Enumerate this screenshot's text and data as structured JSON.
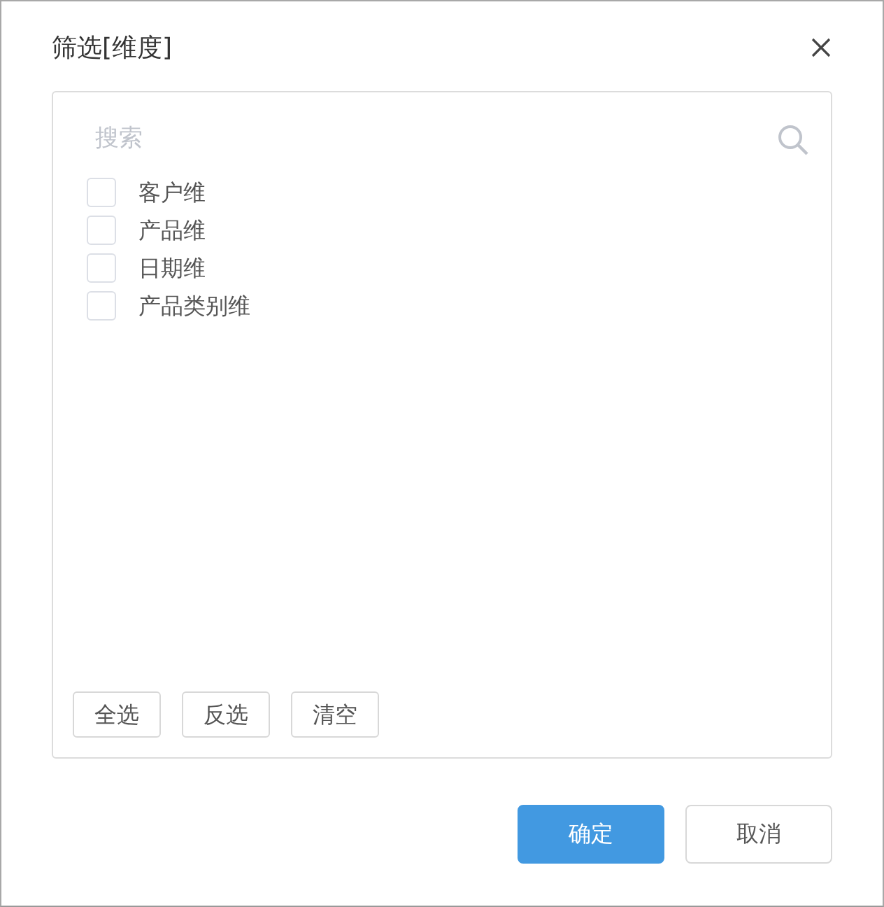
{
  "dialog": {
    "title": "筛选[维度]"
  },
  "search": {
    "placeholder": "搜索"
  },
  "options": [
    {
      "label": "客户维",
      "checked": false
    },
    {
      "label": "产品维",
      "checked": false
    },
    {
      "label": "日期维",
      "checked": false
    },
    {
      "label": "产品类别维",
      "checked": false
    }
  ],
  "selection_buttons": [
    "全选",
    "反选",
    "清空"
  ],
  "footer_buttons": [
    {
      "label": "确定",
      "kind": "primary"
    },
    {
      "label": "取消",
      "kind": "secondary"
    }
  ]
}
